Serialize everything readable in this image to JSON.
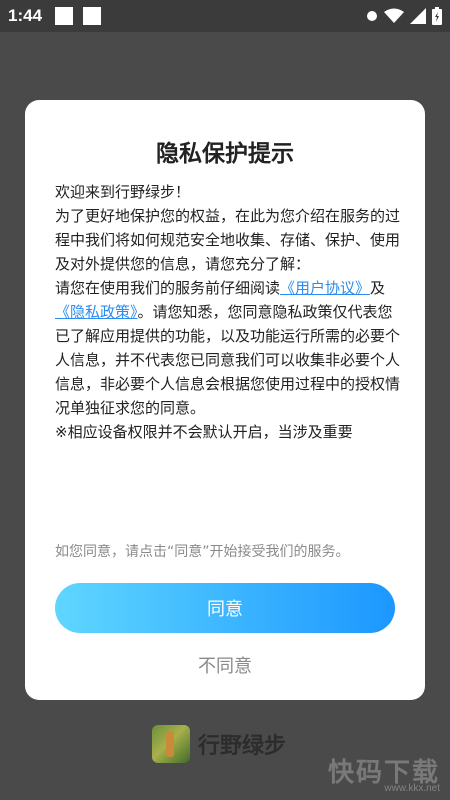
{
  "status_bar": {
    "time": "1:44"
  },
  "background": {
    "app_name": "行野绿步",
    "watermark": "快码下载",
    "watermark_url": "www.kkx.net"
  },
  "dialog": {
    "title": "隐私保护提示",
    "welcome": "欢迎来到行野绿步！",
    "paragraph1": "为了更好地保护您的权益，在此为您介绍在服务的过程中我们将如何规范安全地收集、存储、保护、使用及对外提供您的信息，请您充分了解：",
    "paragraph2_prefix": "请您在使用我们的服务前仔细阅读",
    "user_agreement_link": "《用户协议》",
    "and": "及",
    "privacy_policy_link": "《隐私政策》",
    "paragraph2_suffix": "。请您知悉，您同意隐私政策仅代表您已了解应用提供的功能，以及功能运行所需的必要个人信息，并不代表您已同意我们可以收集非必要个人信息，非必要个人信息会根据您使用过程中的授权情况单独征求您的同意。",
    "paragraph3": "※相应设备权限并不会默认开启，当涉及重要",
    "consent_hint": "如您同意，请点击“同意”开始接受我们的服务。",
    "agree_label": "同意",
    "disagree_label": "不同意"
  },
  "colors": {
    "link": "#2a8cf0",
    "button_gradient_start": "#5fd6ff",
    "button_gradient_end": "#1c97ff",
    "overlay": "#4a4a4a"
  }
}
